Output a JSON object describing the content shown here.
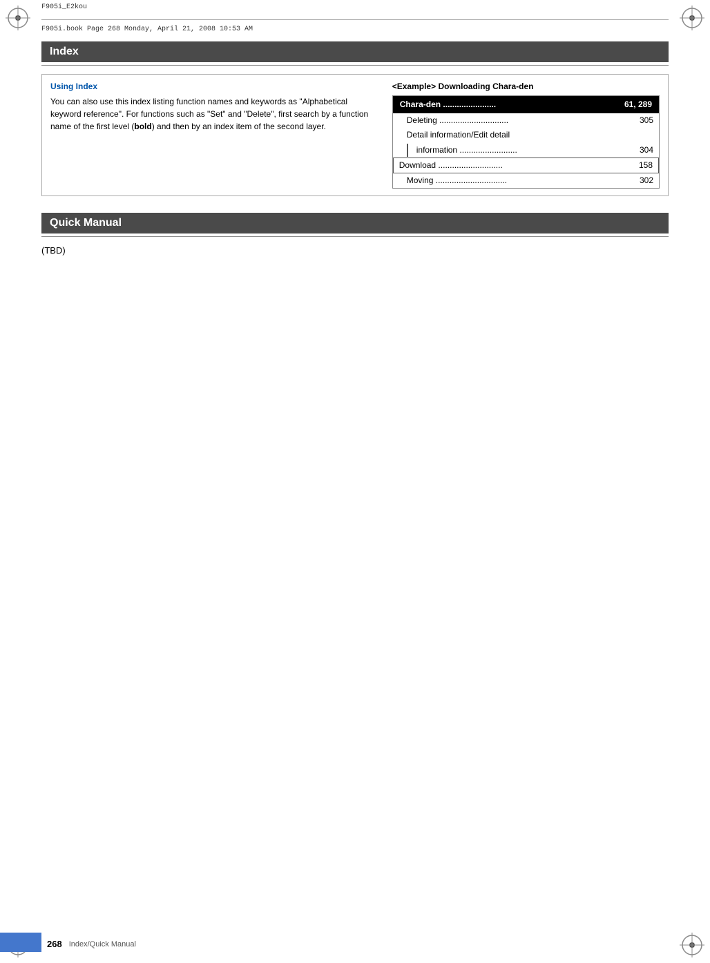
{
  "page": {
    "title": "F905i_E2kou",
    "file_info": "F905i.book  Page 268  Monday, April 21, 2008  10:53 AM",
    "page_number": "268",
    "footer_label": "Index/Quick Manual"
  },
  "index_section": {
    "heading": "Index",
    "using_index": {
      "title": "Using Index",
      "body": "You can also use this index listing function names and keywords as \"Alphabetical keyword reference\". For functions such as \"Set\" and \"Delete\", first search by a function name of the first level (bold) and then by an index item of the second layer.",
      "bold_word": "bold"
    },
    "example": {
      "title": "<Example> Downloading Chara-den",
      "rows": [
        {
          "label": "Chara-den .......................",
          "numbers": "61, 289",
          "style": "highlighted"
        },
        {
          "label": "Deleting ..............................",
          "number": "305",
          "style": "indented"
        },
        {
          "label": "Detail information/Edit detail",
          "number": "",
          "style": "indented"
        },
        {
          "label": "+information .........................",
          "number": "304",
          "style": "indented-bar"
        },
        {
          "label": "Download ............................",
          "number": "158",
          "style": "highlighted-outline"
        },
        {
          "label": "Moving ...............................",
          "number": "302",
          "style": "indented"
        }
      ]
    }
  },
  "quick_manual_section": {
    "heading": "Quick Manual",
    "body": "(TBD)"
  }
}
